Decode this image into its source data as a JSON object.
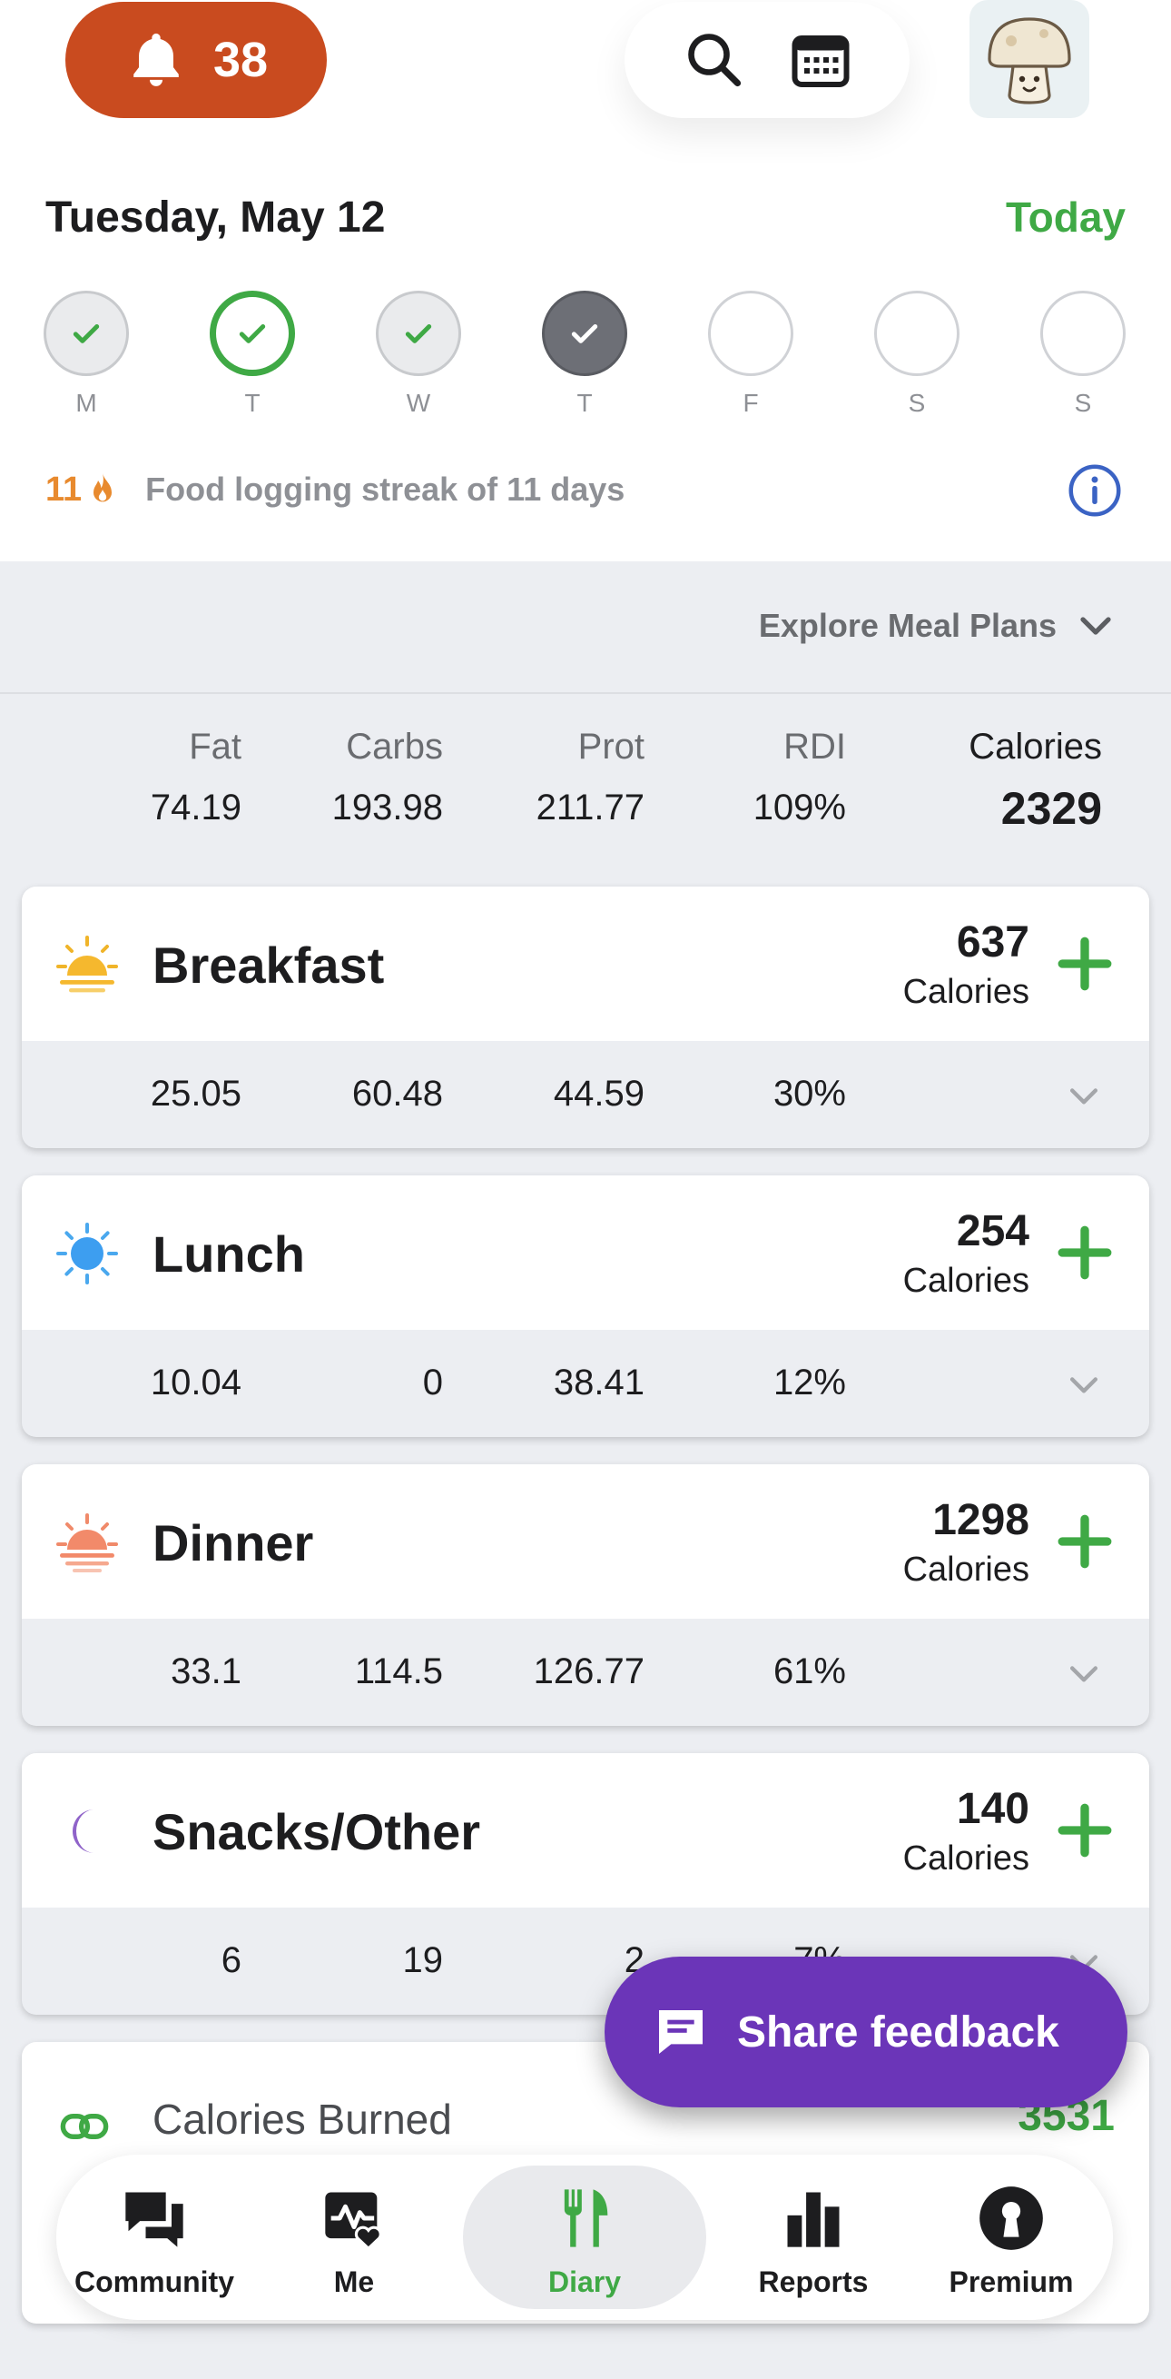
{
  "header": {
    "notification_count": "38",
    "date": "Tuesday, May 12",
    "today_label": "Today"
  },
  "week": {
    "days": [
      {
        "label": "M",
        "state": "done"
      },
      {
        "label": "T",
        "state": "goal"
      },
      {
        "label": "W",
        "state": "done"
      },
      {
        "label": "T",
        "state": "current"
      },
      {
        "label": "F",
        "state": "empty"
      },
      {
        "label": "S",
        "state": "empty"
      },
      {
        "label": "S",
        "state": "empty"
      }
    ]
  },
  "streak": {
    "count": "11",
    "text": "Food logging streak of 11 days"
  },
  "explore_label": "Explore Meal Plans",
  "totals": {
    "headers": {
      "fat": "Fat",
      "carbs": "Carbs",
      "prot": "Prot",
      "rdi": "RDI",
      "calories": "Calories"
    },
    "fat": "74.19",
    "carbs": "193.98",
    "prot": "211.77",
    "rdi": "109%",
    "calories": "2329"
  },
  "meals": [
    {
      "name": "Breakfast",
      "calories": "637",
      "unit": "Calories",
      "fat": "25.05",
      "carbs": "60.48",
      "prot": "44.59",
      "rdi": "30%",
      "icon": "sunrise-icon"
    },
    {
      "name": "Lunch",
      "calories": "254",
      "unit": "Calories",
      "fat": "10.04",
      "carbs": "0",
      "prot": "38.41",
      "rdi": "12%",
      "icon": "sun-icon"
    },
    {
      "name": "Dinner",
      "calories": "1298",
      "unit": "Calories",
      "fat": "33.1",
      "carbs": "114.5",
      "prot": "126.77",
      "rdi": "61%",
      "icon": "sunset-icon"
    },
    {
      "name": "Snacks/Other",
      "calories": "140",
      "unit": "Calories",
      "fat": "6",
      "carbs": "19",
      "prot": "2",
      "rdi": "7%",
      "icon": "moon-icon"
    }
  ],
  "burned": {
    "label": "Calories Burned",
    "value": "3531"
  },
  "feedback_label": "Share feedback",
  "nav": [
    {
      "label": "Community",
      "icon": "chat-icon"
    },
    {
      "label": "Me",
      "icon": "activity-heart-icon"
    },
    {
      "label": "Diary",
      "icon": "fork-knife-icon"
    },
    {
      "label": "Reports",
      "icon": "bar-chart-icon"
    },
    {
      "label": "Premium",
      "icon": "keyhole-icon"
    }
  ],
  "colors": {
    "accent_green": "#3fa945",
    "notification_orange": "#c94b1f",
    "feedback_purple": "#6b35b8",
    "streak_orange": "#e88a2e"
  }
}
